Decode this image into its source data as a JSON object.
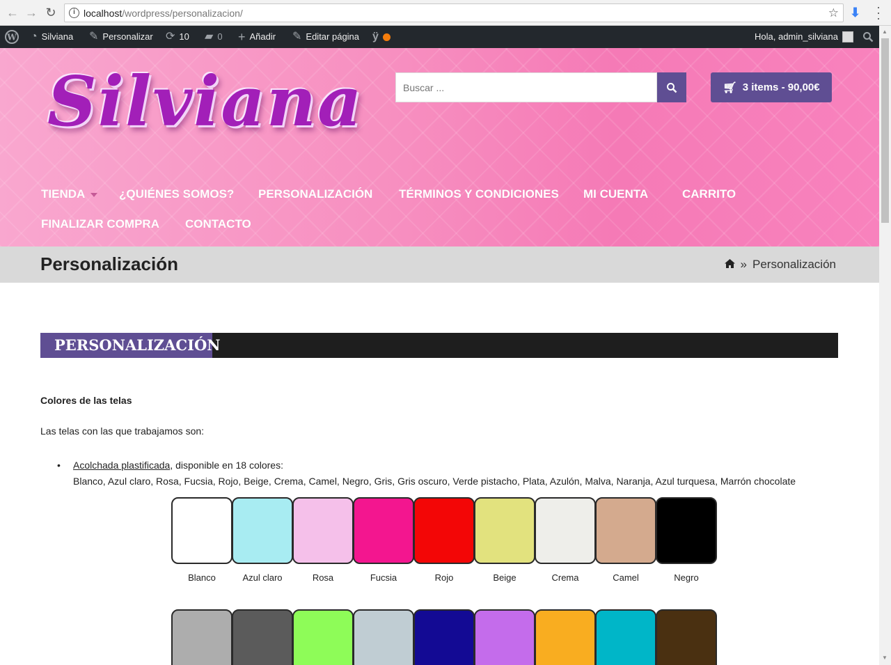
{
  "browser": {
    "url_host": "localhost",
    "url_path": "/wordpress/personalizacion/"
  },
  "adminbar": {
    "site": "Silviana",
    "customize": "Personalizar",
    "updates": "10",
    "comments": "0",
    "add": "Añadir",
    "edit": "Editar página",
    "greeting": "Hola, admin_silviana"
  },
  "header": {
    "logo": "Silviana",
    "search_placeholder": "Buscar ...",
    "cart": "3 items - 90,00€"
  },
  "nav": {
    "items": [
      "TIENDA",
      "¿QUIÉNES SOMOS?",
      "PERSONALIZACIÓN",
      "TÉRMINOS Y CONDICIONES",
      "MI CUENTA",
      "CARRITO",
      "FINALIZAR COMPRA",
      "CONTACTO"
    ]
  },
  "titlebar": {
    "title": "Personalización",
    "separator": "»",
    "crumb": "Personalización"
  },
  "content": {
    "section_title": "PERSONALIZACIÓN",
    "heading": "Colores de las telas",
    "intro": "Las telas con las que trabajamos son:",
    "item_link": "Acolchada plastificada",
    "item_rest": ", disponible en 18 colores:",
    "color_list": "Blanco, Azul claro, Rosa, Fucsia, Rojo, Beige, Crema, Camel, Negro, Gris, Gris oscuro, Verde pistacho, Plata, Azulón, Malva, Naranja, Azul turquesa, Marrón chocolate"
  },
  "swatches_row1": [
    {
      "label": "Blanco",
      "color": "#ffffff"
    },
    {
      "label": "Azul claro",
      "color": "#a8ecf2"
    },
    {
      "label": "Rosa",
      "color": "#f5c0ea"
    },
    {
      "label": "Fucsia",
      "color": "#f3168f"
    },
    {
      "label": "Rojo",
      "color": "#f30606"
    },
    {
      "label": "Beige",
      "color": "#e2e27e"
    },
    {
      "label": "Crema",
      "color": "#eeeeea"
    },
    {
      "label": "Camel",
      "color": "#d4aa8e"
    },
    {
      "label": "Negro",
      "color": "#000000"
    }
  ],
  "swatches_row2": [
    {
      "color": "#adadad"
    },
    {
      "color": "#5b5b5b"
    },
    {
      "color": "#8efc58"
    },
    {
      "color": "#c0cdd3"
    },
    {
      "color": "#130a94"
    },
    {
      "color": "#c46ceb"
    },
    {
      "color": "#f9ad20"
    },
    {
      "color": "#00b6c8"
    },
    {
      "color": "#4a3011"
    }
  ]
}
